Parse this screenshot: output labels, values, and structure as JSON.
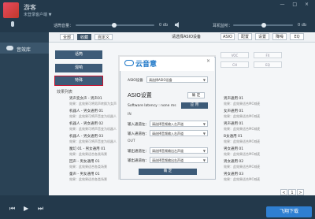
{
  "header": {
    "title": "游客",
    "subtitle": "未登录客户端 ▼",
    "window_controls": "— □ ×"
  },
  "mixer": {
    "mic_label": "话筒音量：",
    "mic_db": "0 db",
    "monitor_label": "耳机监听：",
    "monitor_db": "0 db"
  },
  "sidebar": {
    "items": [
      {
        "label": "音效库"
      }
    ]
  },
  "toolbar": {
    "tabs": [
      {
        "label": "全部"
      },
      {
        "label": "收藏"
      },
      {
        "label": "自定义"
      }
    ],
    "device_label": "请选择ASIO设备",
    "buttons": [
      "ASIO",
      "配置",
      "设置",
      "降噪",
      "EQ"
    ]
  },
  "effects": {
    "buttons": [
      "话筒",
      "混响",
      "特殊"
    ],
    "grid": [
      "VOC",
      "FX",
      "CH",
      "EQ"
    ]
  },
  "list": {
    "title": "效果列表",
    "items": [
      {
        "name": "男声变女声 - 男声01",
        "desc": "效果：此效果可将男声转换为女声"
      },
      {
        "name": "机器人 - 男女通用 01",
        "desc": "效果：此效果可将声音变为机器人"
      },
      {
        "name": "机器人 - 男女通用 02",
        "desc": "效果：此效果可将声音变为机器人"
      },
      {
        "name": "机器人 - 男女通用 03",
        "desc": "效果：此效果可将声音变为机器人"
      },
      {
        "name": "魔幻 01 - 男女通用 01",
        "desc": "效果：此效果适合各类场景"
      },
      {
        "name": "回声 - 男女通用 01",
        "desc": "效果：此效果适合各类场景"
      },
      {
        "name": "童声 - 男女通用 01",
        "desc": "效果：此效果适合各类场景"
      }
    ],
    "right_items": [
      {
        "name": "男声通用 01",
        "desc": "效果：此效果适合MC喊麦"
      },
      {
        "name": "女声通用 01",
        "desc": "效果：此效果适合MC喊麦"
      },
      {
        "name": "男声通用 01",
        "desc": "效果：此效果适合MC喊麦"
      },
      {
        "name": "B女通用 01",
        "desc": "效果：此效果适合MC喊麦"
      },
      {
        "name": "男女通用 01",
        "desc": "效果：此效果适合MC喊麦"
      },
      {
        "name": "男女通用 02",
        "desc": "效果：此效果适合MC喊麦"
      },
      {
        "name": "男女通用 03",
        "desc": "效果：此效果适合MC喊麦"
      }
    ]
  },
  "pager": {
    "prev": "<",
    "page": "1",
    "next": ">"
  },
  "modal": {
    "brand": "云音意",
    "close": "×",
    "asio_device_label": "ASIO设备",
    "asio_device_value": "请选择ASIO设备",
    "asio_title": "ASIO设置",
    "asio_setting_button": "确 定",
    "latency_label": "Software latency : none ms",
    "apply_button": "应 用",
    "in_label": "IN",
    "input_left_label": "输入通道左：",
    "input_left_value": "请选择音频输入左声道",
    "input_right_label": "输入通道右：",
    "input_right_value": "请选择音频输入右声道",
    "out_label": "OUT",
    "output_left_label": "输出通道左：",
    "output_left_value": "请选择音频输出左声道",
    "output_right_label": "输出通道右：",
    "output_right_value": "请选择音频输出右声道",
    "confirm_button": "确 定"
  },
  "watermark": "飞翔下载"
}
